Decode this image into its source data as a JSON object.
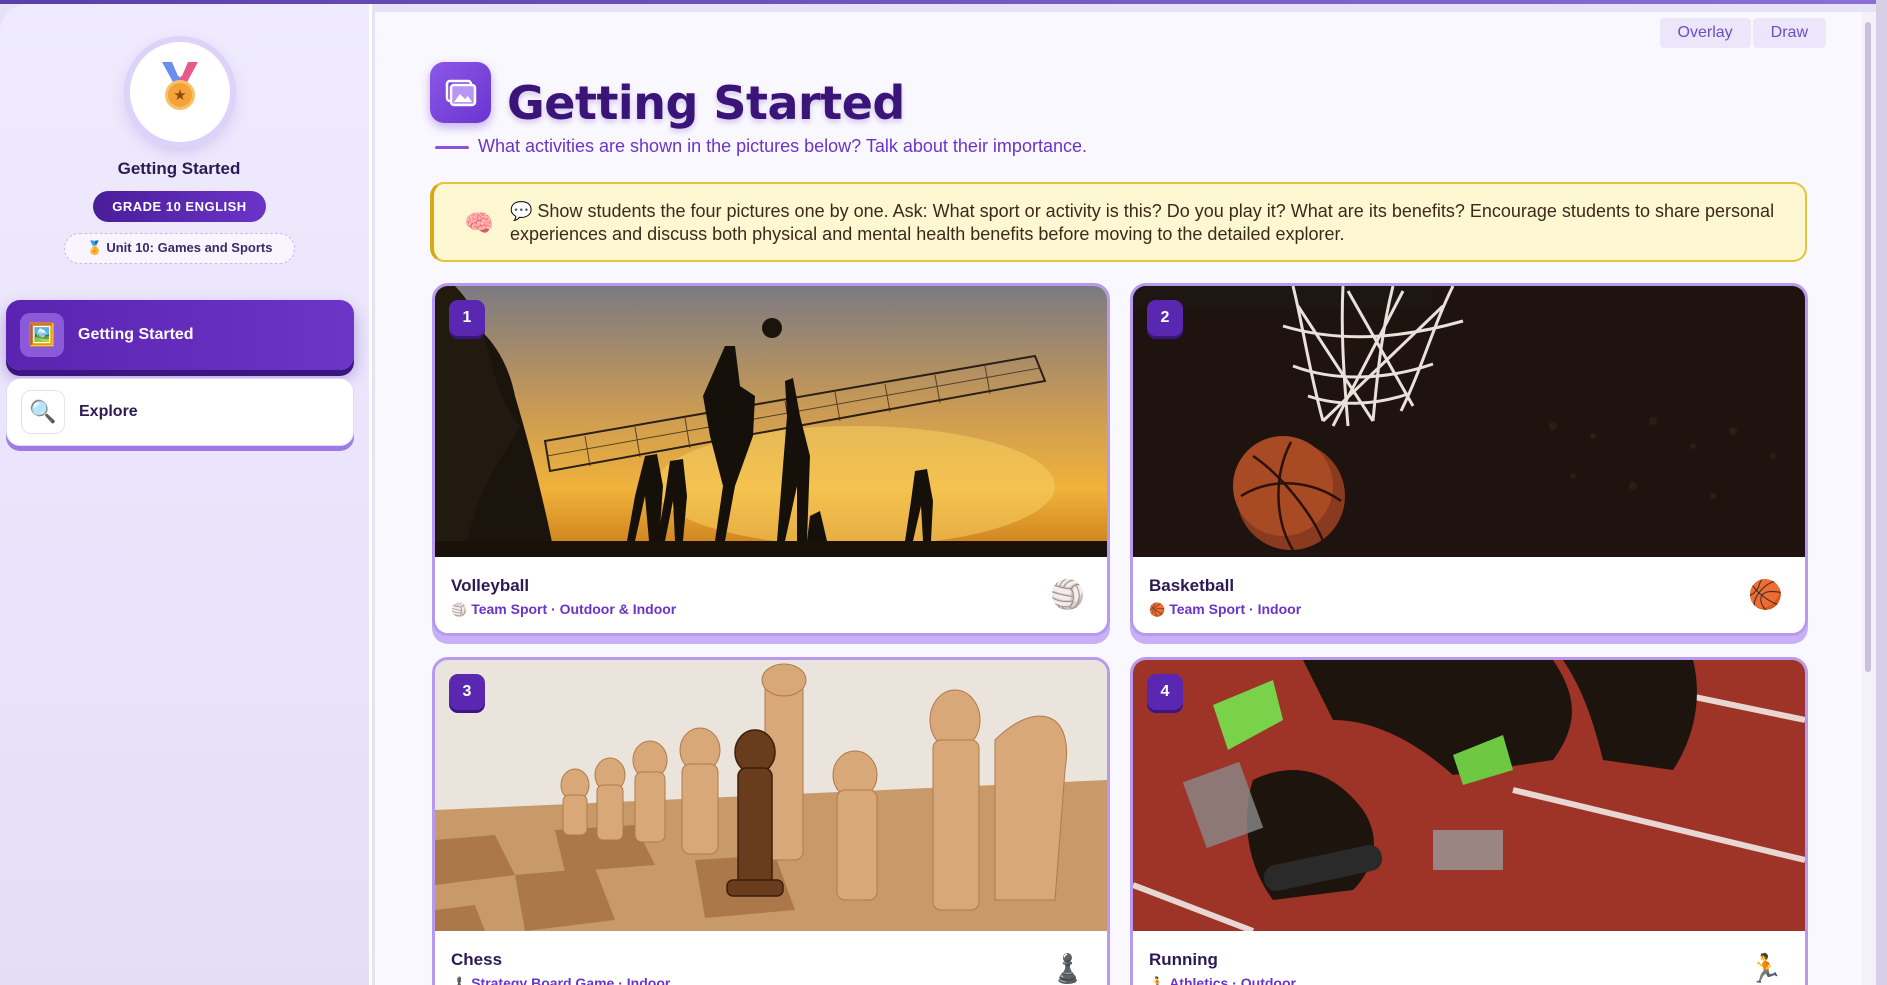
{
  "sidebar": {
    "title": "Getting Started",
    "grade": "GRADE 10 ENGLISH",
    "unit": "🏅 Unit 10: Games and Sports",
    "medal_icon": "medal-icon",
    "nav": [
      {
        "label": "Getting Started",
        "icon": "🖼️",
        "active": true
      },
      {
        "label": "Explore",
        "icon": "🔍",
        "active": false
      }
    ]
  },
  "toolbar": {
    "overlay_label": "Overlay",
    "draw_label": "Draw"
  },
  "main": {
    "title": "Getting Started",
    "subtitle": "What activities are shown in the pictures below? Talk about their importance.",
    "note_icon": "🧠",
    "note": "💬 Show students the four pictures one by one. Ask: What sport or activity is this? Do you play it? What are its benefits? Encourage students to share personal experiences and discuss both physical and mental health benefits before moving to the detailed explorer.",
    "cards": [
      {
        "num": "1",
        "title": "Volleyball",
        "sub": "Team Sport · Outdoor & Indoor",
        "emoji": "🏐"
      },
      {
        "num": "2",
        "title": "Basketball",
        "sub": "Team Sport · Indoor",
        "emoji": "🏀"
      },
      {
        "num": "3",
        "title": "Chess",
        "sub": "Strategy Board Game · Indoor",
        "emoji": "♟️"
      },
      {
        "num": "4",
        "title": "Running",
        "sub": "Athletics · Outdoor",
        "emoji": "🏃"
      }
    ]
  },
  "colors": {
    "accent": "#6b34c8",
    "title": "#3a1478",
    "note_bg": "#fdf8d2",
    "note_border": "#e6c43a"
  }
}
